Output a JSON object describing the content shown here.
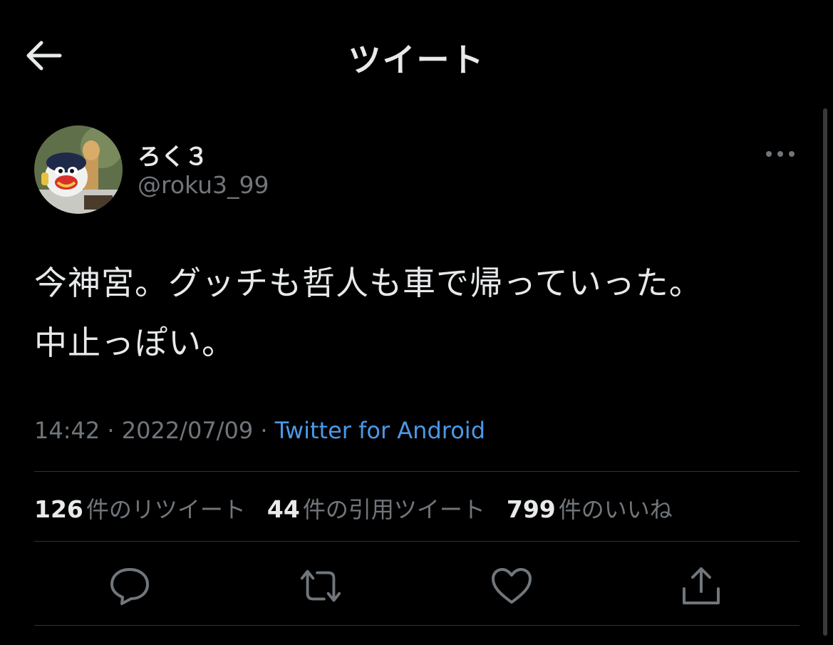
{
  "header": {
    "title": "ツイート",
    "back_icon": "arrow-left-icon"
  },
  "author": {
    "display_name": "ろく３",
    "handle": "@roku3_99",
    "avatar_icon": "avatar-image",
    "more_icon": "more-horizontal-icon"
  },
  "tweet": {
    "lines": [
      "今神宮。グッチも哲人も車で帰っていった。",
      "中止っぽい。"
    ]
  },
  "meta": {
    "time": "14:42",
    "separator": "·",
    "date": "2022/07/09",
    "source": "Twitter for Android"
  },
  "stats": {
    "retweets": {
      "count": "126",
      "label": "件のリツイート"
    },
    "quotes": {
      "count": "44",
      "label": "件の引用ツイート"
    },
    "likes": {
      "count": "799",
      "label": "件のいいね"
    }
  },
  "actions": [
    {
      "name": "reply",
      "icon": "reply-icon"
    },
    {
      "name": "retweet",
      "icon": "retweet-icon"
    },
    {
      "name": "like",
      "icon": "heart-icon"
    },
    {
      "name": "share",
      "icon": "share-icon"
    }
  ],
  "colors": {
    "background": "#000000",
    "text": "#e7e9ea",
    "secondary": "#71767b",
    "link": "#4a99e9",
    "divider": "#2f3336"
  }
}
